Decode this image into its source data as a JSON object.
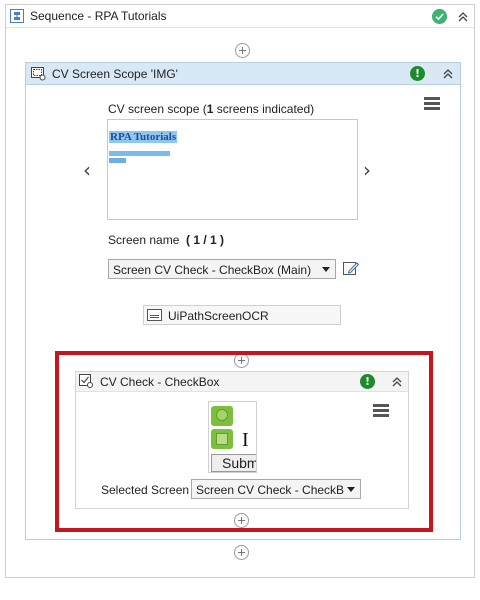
{
  "sequence": {
    "title": "Sequence - RPA Tutorials"
  },
  "scope": {
    "title": "CV Screen Scope 'IMG'",
    "screens_label_prefix": "CV screen scope (",
    "screens_count": "1",
    "screens_label_suffix": " screens indicated)",
    "preview": {
      "title": "RPA Tutorials"
    },
    "screen_name_label": "Screen name",
    "screen_index": "( 1 / 1 )",
    "screen_select_value": "Screen CV Check - CheckBox (Main)",
    "ocr_engine": "UiPathScreenOCR"
  },
  "cv_check": {
    "title": "CV Check - CheckBox",
    "thumbnail": {
      "letter": "I",
      "button_label": "Submit"
    },
    "selected_screen_label": "Selected Screen",
    "selected_screen_value": "Screen CV Check - CheckBox"
  },
  "colors": {
    "success": "#3cb371",
    "warning": "#1e8a2e",
    "highlight_border": "#c4161c",
    "scope_header": "#d9e8f5"
  },
  "icons": {
    "sequence": "sequence-icon",
    "status_ok": "check-circle-icon",
    "collapse": "chevron-double-up-icon",
    "add": "plus-circle-icon",
    "warning": "exclamation-circle-icon",
    "menu": "hamburger-menu-icon",
    "prev": "chevron-left-icon",
    "next": "chevron-right-icon",
    "edit": "edit-pencil-icon",
    "ocr": "ocr-engine-icon"
  },
  "warning_glyph": "!"
}
